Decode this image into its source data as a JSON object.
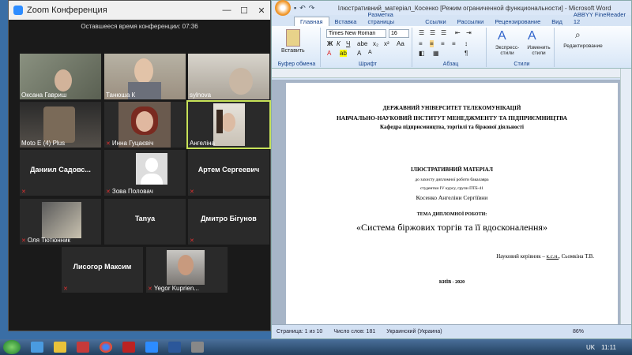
{
  "zoom": {
    "title": "Zoom Конференция",
    "timer": "Оставшееся время конференции: 07:36",
    "participants": [
      {
        "name": "Оксана Гавриш",
        "type": "video"
      },
      {
        "name": "Танюша К",
        "type": "video"
      },
      {
        "name": "sylnova",
        "type": "video"
      },
      {
        "name": "Moto E (4) Plus",
        "type": "video"
      },
      {
        "name": "Инна Гуцаєвіч",
        "type": "video"
      },
      {
        "name": "Ангеліна",
        "type": "video"
      },
      {
        "name": "Даниил  Садовс...",
        "type": "name"
      },
      {
        "name": "Зова Половач",
        "type": "avatar"
      },
      {
        "name": "Артем Сергеевич",
        "type": "name"
      },
      {
        "name": "Оля Тютюнник",
        "type": "video"
      },
      {
        "name": "Tanya",
        "type": "name"
      },
      {
        "name": "Дмитро Бігунов",
        "type": "name"
      },
      {
        "name": "Лисогор Максим",
        "type": "name"
      },
      {
        "name": "Yegor Kuprien...",
        "type": "video"
      }
    ]
  },
  "word": {
    "title": "Ілюстративний_матеріал_Косенко [Режим ограниченной функциональности] - Microsoft Word",
    "tabs": [
      "Главная",
      "Вставка",
      "Разметка страницы",
      "Ссылки",
      "Рассылки",
      "Рецензирование",
      "Вид",
      "ABBYY FineReader 12"
    ],
    "ribbon": {
      "paste": "Вставить",
      "clipboard": "Буфер обмена",
      "font_name": "Times New Roman",
      "font_size": "16",
      "font_group": "Шрифт",
      "paragraph_group": "Абзац",
      "express_styles": "Экспресс-стили",
      "change_styles": "Изменить стили",
      "styles_group": "Стили",
      "editing": "Редактирование"
    },
    "doc": {
      "l1": "ДЕРЖАВНИЙ УНІВЕРСИТЕТ ТЕЛЕКОМУНІКАЦІЙ",
      "l2": "НАВЧАЛЬНО-НАУКОВИЙ ІНСТИТУТ МЕНЕДЖМЕНТУ ТА ПІДПРИЄМНИЦТВА",
      "l3": "Кафедра підприємництва, торгівлі та біржової діяльності",
      "l4": "ІЛЮСТРАТИВНИЙ МАТЕРІАЛ",
      "l5": "до захисту дипломної роботи бакалавра",
      "l6": "студентки IV курсу, групи ПТБ-41",
      "l7": "Косенко Ангеліни Сергіївни",
      "l8": "ТЕМА ДИПЛОМНОЇ РОБОТИ:",
      "l9": "«Система біржових торгів та її вдосконалення»",
      "l10a": "Науковий керівник – ",
      "l10b": "к.с.н.",
      "l10c": ", Сьомкіна Т.В.",
      "l11": "КИЇВ - 2020"
    },
    "status": {
      "page": "Страница: 1 из 10",
      "words": "Число слов: 181",
      "lang": "Украинский (Украина)",
      "zoom": "86%"
    }
  },
  "taskbar": {
    "lang": "UK",
    "time": "11:11"
  }
}
